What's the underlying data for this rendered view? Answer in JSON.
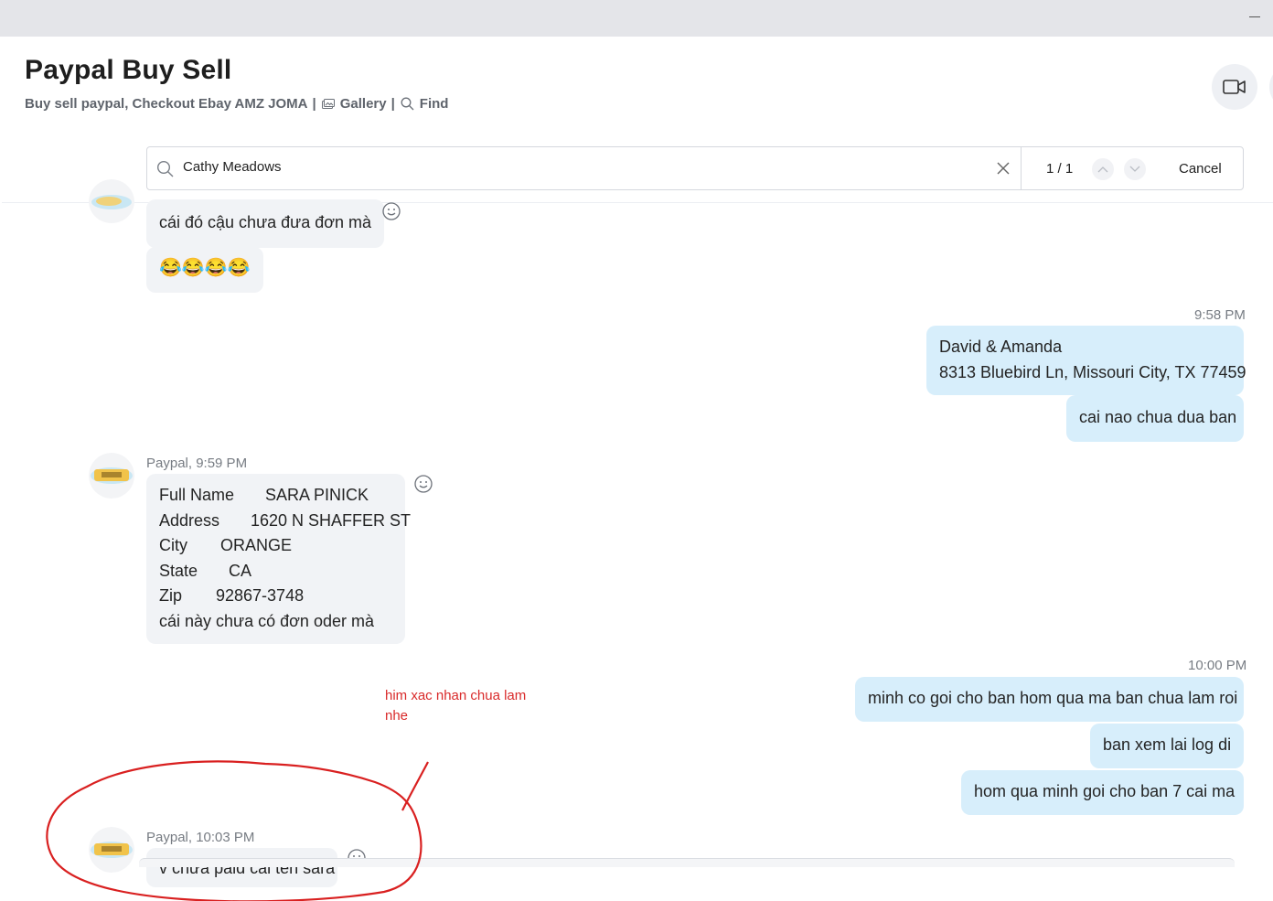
{
  "window": {
    "minimize_label": "—"
  },
  "header": {
    "title": "Paypal Buy Sell",
    "description": "Buy sell paypal, Checkout Ebay AMZ JOMA",
    "separator": "|",
    "gallery_label": "Gallery",
    "find_label": "Find"
  },
  "search": {
    "value": "Cathy Meadows",
    "counter": "1 / 1",
    "cancel_label": "Cancel"
  },
  "messages": {
    "m1_text": "cái đó cậu chưa đưa đơn mà",
    "m2_text": "😂😂😂😂",
    "m3_time": "9:58 PM",
    "m3_line1": "David & Amanda",
    "m3_line2": "8313 Bluebird Ln, Missouri City, TX 77459",
    "m4_text": "cai nao chua dua ban",
    "m5_meta": "Paypal, 9:59 PM",
    "m5_rows": [
      {
        "k": "Full Name",
        "v": "SARA PINICK"
      },
      {
        "k": "Address",
        "v": "1620 N SHAFFER ST"
      },
      {
        "k": "City",
        "v": "ORANGE"
      },
      {
        "k": "State",
        "v": "CA"
      },
      {
        "k": "Zip",
        "v": "92867-3748"
      }
    ],
    "m5_last": "cái này chưa có đơn oder mà",
    "m6_time": "10:00 PM",
    "m6_text": "minh co goi cho ban hom qua ma ban chua lam roi",
    "m7_text": "ban xem lai log di",
    "m8_text": "hom qua minh goi cho ban 7 cai ma",
    "m9_meta": "Paypal, 10:03 PM",
    "m9_text": "v chưa paid cái tên sara"
  },
  "annotation": {
    "text": "him xac nhan chua lam nhe",
    "color": "#d92b2b"
  },
  "colors": {
    "outgoing_bubble": "#d7eefb",
    "incoming_bubble": "#f1f3f6",
    "titlebar": "#e4e5e9"
  }
}
